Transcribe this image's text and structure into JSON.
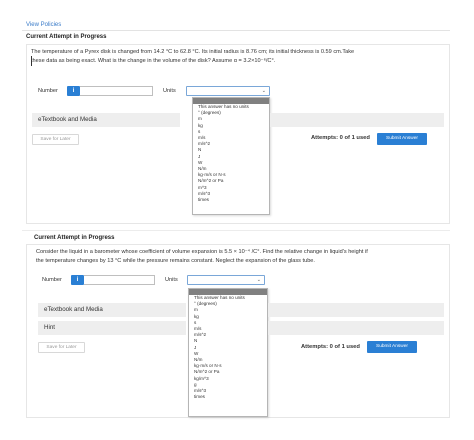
{
  "link": "View Policies",
  "q1": {
    "heading": "Current Attempt in Progress",
    "text_line1": "The temperature of a Pyrex disk is changed from 14.2 °C to 62.8 °C. Its initial radius is 8.76 cm; its initial thickness is 0.59 cm.Take",
    "text_line2": "these data as being exact. What is the change in the volume of the disk? Assume α = 3.2×10⁻⁶/C°.",
    "number_label": "Number",
    "info_label": "i",
    "units_label": "Units",
    "number_value": "",
    "units_value": "",
    "etextbook_label": "eTextbook and Media",
    "save_label": "Save for Later",
    "attempts_label": "Attempts: 0 of 1 used",
    "submit_label": "Submit Answer"
  },
  "q2": {
    "heading": "Current Attempt in Progress",
    "text_line1": "Consider the liquid in a barometer whose coefficient of volume expansion is 5.5 × 10⁻⁴ /C°. Find the relative change in liquid's height if",
    "text_line2": "the temperature changes by 13 °C while the pressure remains constant. Neglect the expansion of the glass tube.",
    "number_label": "Number",
    "info_label": "i",
    "units_label": "Units",
    "number_value": "",
    "units_value": "",
    "etextbook_label": "eTextbook and Media",
    "hint_label": "Hint",
    "save_label": "Save for Later",
    "attempts_label": "Attempts: 0 of 1 used",
    "submit_label": "Submit Answer"
  },
  "dropdown1_options": [
    "This answer has no units",
    "° (degrees)",
    "m",
    "kg",
    "s",
    "m/s",
    "m/s^2",
    "N",
    "J",
    "W",
    "N/m",
    "kg·m/s or N·s",
    "N/m^2 or Pa",
    "m^3",
    "m/s^3",
    "times"
  ],
  "dropdown2_options": [
    "This answer has no units",
    "° (degrees)",
    "m",
    "kg",
    "s",
    "m/s",
    "m/s^2",
    "N",
    "J",
    "W",
    "N/m",
    "kg·m/s or N·s",
    "N/m^2 or Pa",
    "kg/m^3",
    "g",
    "m/s^3",
    "times"
  ],
  "colors": {
    "accent": "#2a7fd4",
    "link": "#3a7bc8",
    "bar_bg": "#eeeeee",
    "dropdown_selected": "#808080"
  },
  "icons": {
    "dropdown": "chevron-down-icon",
    "info": "info-icon"
  }
}
